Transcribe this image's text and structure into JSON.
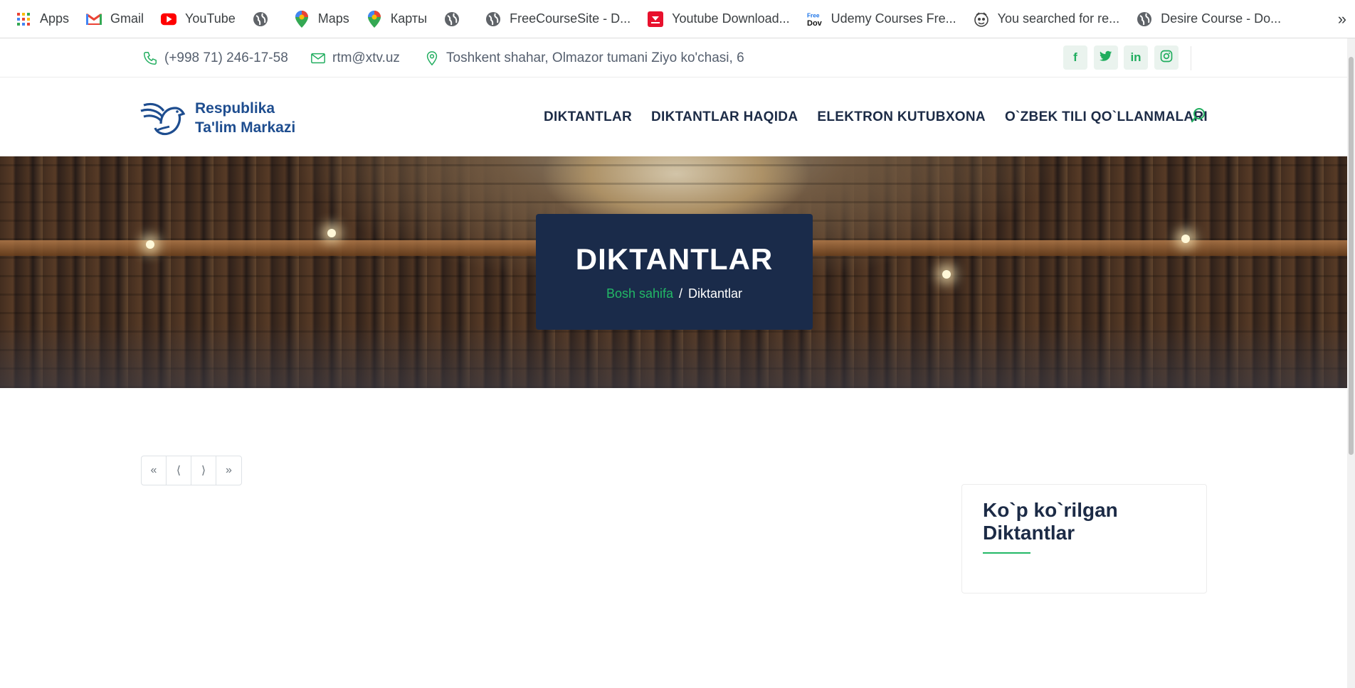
{
  "bookmarks": {
    "items": [
      {
        "label": "Apps",
        "icon": "apps-grid-icon"
      },
      {
        "label": "Gmail",
        "icon": "gmail-icon"
      },
      {
        "label": "YouTube",
        "icon": "youtube-icon"
      },
      {
        "label": "",
        "icon": "globe-icon"
      },
      {
        "label": "Maps",
        "icon": "maps-pin-icon"
      },
      {
        "label": "Карты",
        "icon": "maps-pin-icon"
      },
      {
        "label": "",
        "icon": "globe-icon"
      },
      {
        "label": "FreeCourseSite - D...",
        "icon": "globe-icon"
      },
      {
        "label": "Youtube Download...",
        "icon": "download-icon"
      },
      {
        "label": "Udemy Courses Fre...",
        "icon": "free-download-icon"
      },
      {
        "label": "You searched for re...",
        "icon": "site-logo-icon"
      },
      {
        "label": "Desire Course - Do...",
        "icon": "globe-icon"
      }
    ],
    "more": "»"
  },
  "topbar": {
    "phone": "(+998 71) 246-17-58",
    "email": "rtm@xtv.uz",
    "address": "Toshkent shahar, Olmazor tumani Ziyo ko'chasi, 6",
    "social": [
      "f",
      "t",
      "in",
      "ig"
    ]
  },
  "header": {
    "logo_line1": "Respublika",
    "logo_line2": "Ta'lim Markazi",
    "nav": [
      "DIKTANTLAR",
      "DIKTANTLAR HAQIDA",
      "ELEKTRON KUTUBXONA",
      "O`ZBEK TILI QO`LLANMALARI"
    ]
  },
  "hero": {
    "title": "DIKTANTLAR",
    "breadcrumb_home": "Bosh sahifa",
    "breadcrumb_sep": "/",
    "breadcrumb_current": "Diktantlar"
  },
  "pagination": [
    "«",
    "⟨",
    "⟩",
    "»"
  ],
  "sidebar": {
    "title_line1": "Ko`p ko`rilgan",
    "title_line2": "Diktantlar"
  },
  "colors": {
    "accent": "#22b866",
    "navy": "#1a2b4a",
    "text": "#1c2b46"
  }
}
